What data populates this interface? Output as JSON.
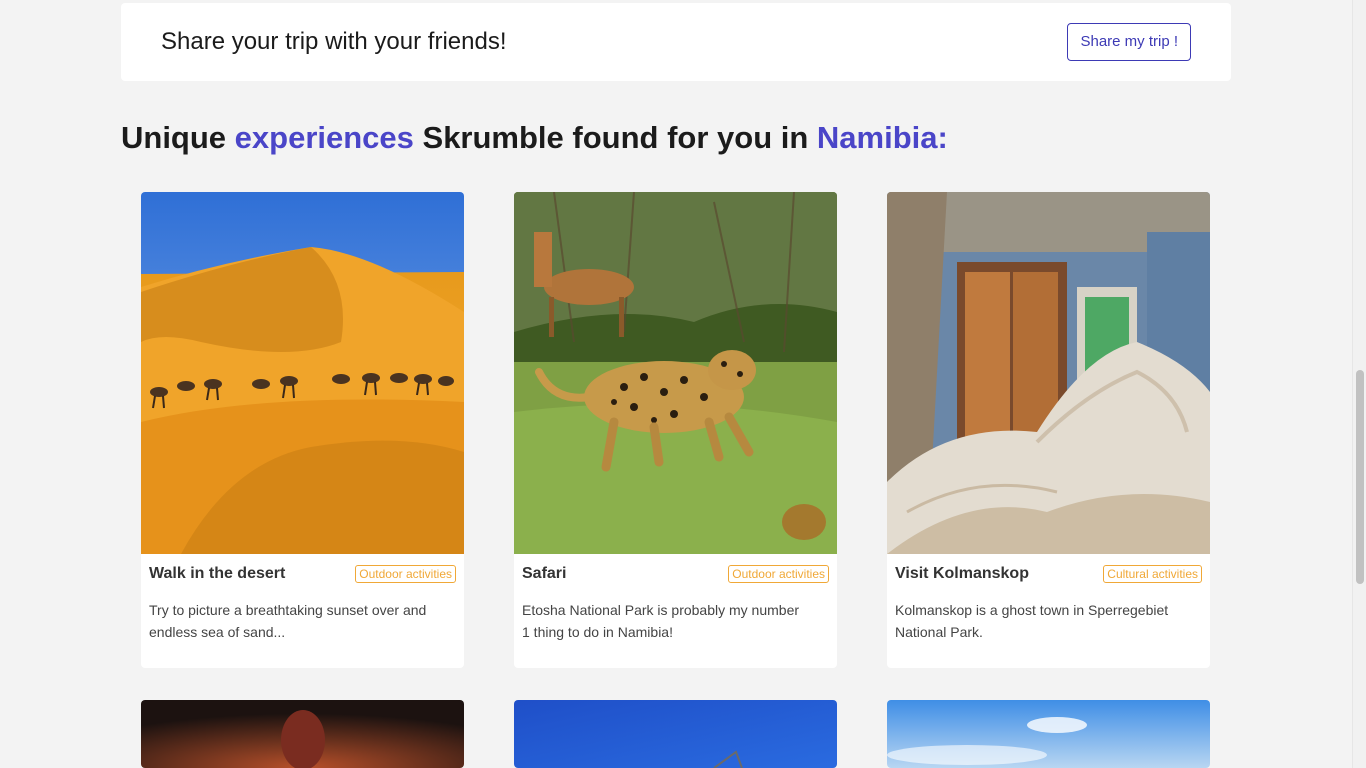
{
  "share": {
    "text": "Share your trip with your friends!",
    "button_label": "Share my trip !"
  },
  "heading": {
    "part1": "Unique ",
    "accent1": "experiences",
    "part2": " Skrumble found for you in ",
    "accent2": "Namibia:"
  },
  "cards": [
    {
      "title": "Walk in the desert",
      "tag": "Outdoor activities",
      "description": "Try to picture a breathtaking sunset over and endless sea of sand...",
      "image": "desert-dunes-camels"
    },
    {
      "title": "Safari",
      "tag": "Outdoor activities",
      "description": "Etosha National Park is probably my number 1 thing to do in Namibia!",
      "image": "leopard-impala-savanna"
    },
    {
      "title": "Visit Kolmanskop",
      "tag": "Cultural activities",
      "description": "Kolmanskop is a ghost town in Sperregebiet National Park.",
      "image": "sand-filled-abandoned-room"
    }
  ],
  "colors": {
    "accent": "#4a45c8",
    "tag": "#f0a837",
    "background": "#f3f3f3"
  }
}
